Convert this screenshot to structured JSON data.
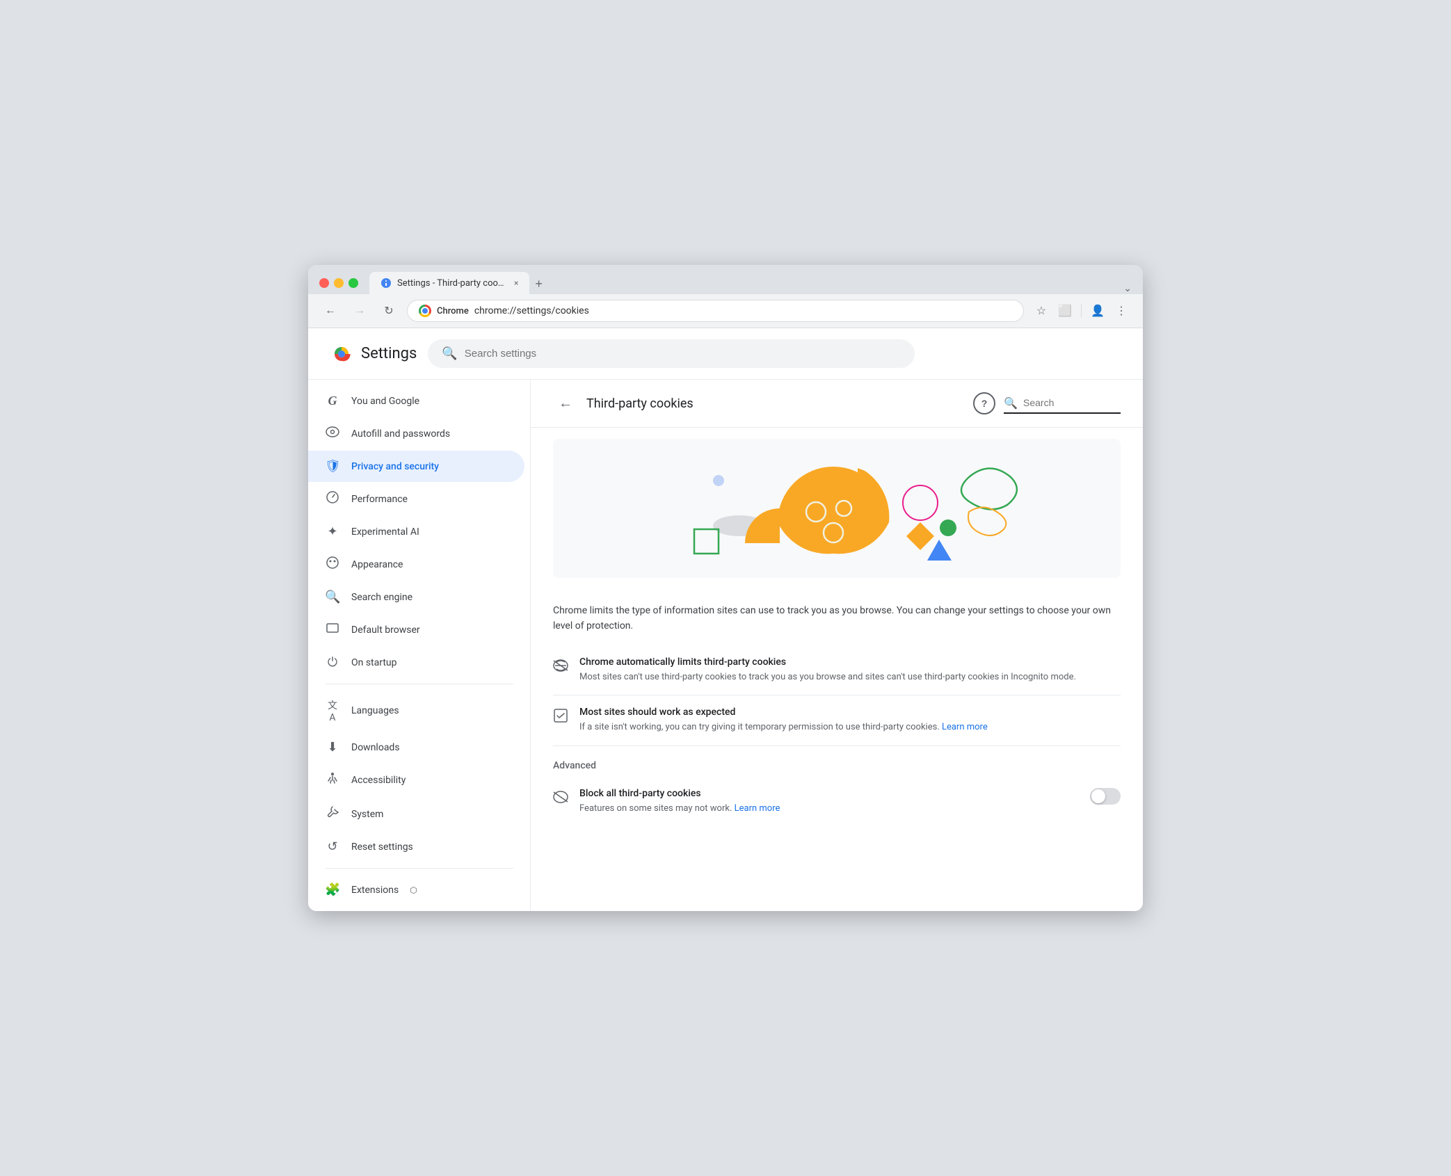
{
  "browser": {
    "traffic_lights": [
      "red",
      "yellow",
      "green"
    ],
    "tab": {
      "favicon_label": "settings-favicon",
      "title": "Settings - Third-party cookie",
      "close_label": "×"
    },
    "tab_add_label": "+",
    "tab_end_label": "⌄",
    "nav": {
      "back_label": "←",
      "forward_label": "→",
      "refresh_label": "↻",
      "chrome_label": "Chrome",
      "address": "chrome://settings/cookies",
      "bookmark_icon": "☆",
      "extension_icon": "⬜",
      "profile_icon": "👤",
      "menu_icon": "⋮"
    }
  },
  "settings": {
    "title": "Settings",
    "search_placeholder": "Search settings"
  },
  "sidebar": {
    "items": [
      {
        "id": "you-and-google",
        "icon": "G",
        "label": "You and Google",
        "active": false
      },
      {
        "id": "autofill",
        "icon": "🔑",
        "label": "Autofill and passwords",
        "active": false
      },
      {
        "id": "privacy",
        "icon": "🛡",
        "label": "Privacy and security",
        "active": true
      },
      {
        "id": "performance",
        "icon": "⚡",
        "label": "Performance",
        "active": false
      },
      {
        "id": "experimental-ai",
        "icon": "✦",
        "label": "Experimental AI",
        "active": false
      },
      {
        "id": "appearance",
        "icon": "🎨",
        "label": "Appearance",
        "active": false
      },
      {
        "id": "search-engine",
        "icon": "🔍",
        "label": "Search engine",
        "active": false
      },
      {
        "id": "default-browser",
        "icon": "⬜",
        "label": "Default browser",
        "active": false
      },
      {
        "id": "on-startup",
        "icon": "⏻",
        "label": "On startup",
        "active": false
      }
    ],
    "items2": [
      {
        "id": "languages",
        "icon": "文A",
        "label": "Languages",
        "active": false
      },
      {
        "id": "downloads",
        "icon": "⬇",
        "label": "Downloads",
        "active": false
      },
      {
        "id": "accessibility",
        "icon": "♿",
        "label": "Accessibility",
        "active": false
      },
      {
        "id": "system",
        "icon": "⚙",
        "label": "System",
        "active": false
      },
      {
        "id": "reset",
        "icon": "↺",
        "label": "Reset settings",
        "active": false
      }
    ],
    "items3": [
      {
        "id": "extensions",
        "icon": "🧩",
        "label": "Extensions",
        "active": false,
        "external": true
      }
    ]
  },
  "main": {
    "back_label": "←",
    "page_title": "Third-party cookies",
    "help_label": "?",
    "search_placeholder": "Search",
    "description": "Chrome limits the type of information sites can use to track you as you browse. You can change your settings to choose your own level of protection.",
    "options": [
      {
        "id": "auto-limit",
        "icon": "👁",
        "title": "Chrome automatically limits third-party cookies",
        "desc": "Most sites can't use third-party cookies to track you as you browse and sites can't use third-party cookies in Incognito mode.",
        "link": null,
        "has_toggle": false
      },
      {
        "id": "most-sites",
        "icon": "☑",
        "title": "Most sites should work as expected",
        "desc": "If a site isn't working, you can try giving it temporary permission to use third-party cookies.",
        "link": "Learn more",
        "link_text": "Learn more",
        "has_toggle": false
      }
    ],
    "advanced_label": "Advanced",
    "advanced_options": [
      {
        "id": "block-all",
        "icon": "👁",
        "title": "Block all third-party cookies",
        "desc": "Features on some sites may not work.",
        "link": "Learn more",
        "link_text": "Learn more",
        "has_toggle": true,
        "toggle_on": false
      }
    ]
  }
}
